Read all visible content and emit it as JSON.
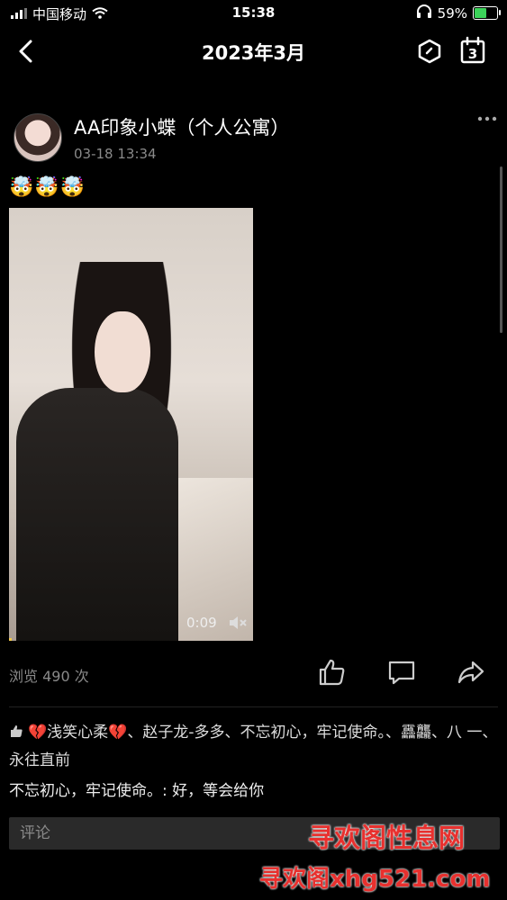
{
  "status_bar": {
    "carrier": "中国移动",
    "time": "15:38",
    "battery": "59%",
    "battery_level": 0.59
  },
  "nav": {
    "title": "2023年3月",
    "calendar_day": "3"
  },
  "post": {
    "author": "AA印象小蝶（个人公寓）",
    "date": "03-18 13:34",
    "emoji_text": "🤯🤯🤯",
    "video": {
      "duration": "0:09",
      "progress": 0.0
    },
    "views": "浏览 490 次",
    "likes_text": "💔浅笑心柔💔、赵子龙-多多、不忘初心，牢记使命。、靐龘、八 一、永往直前",
    "comment": "不忘初心，牢记使命。: 好，等会给你"
  },
  "comment_input": {
    "placeholder": "评论"
  },
  "watermark": {
    "line1": "寻欢阁性息网",
    "line2": "寻欢阁xhg521.com"
  },
  "colors": {
    "background": "#000000",
    "battery_fill": "#3cd35a",
    "muted_text": "#8a8a8a",
    "watermark": "#e8302e"
  }
}
